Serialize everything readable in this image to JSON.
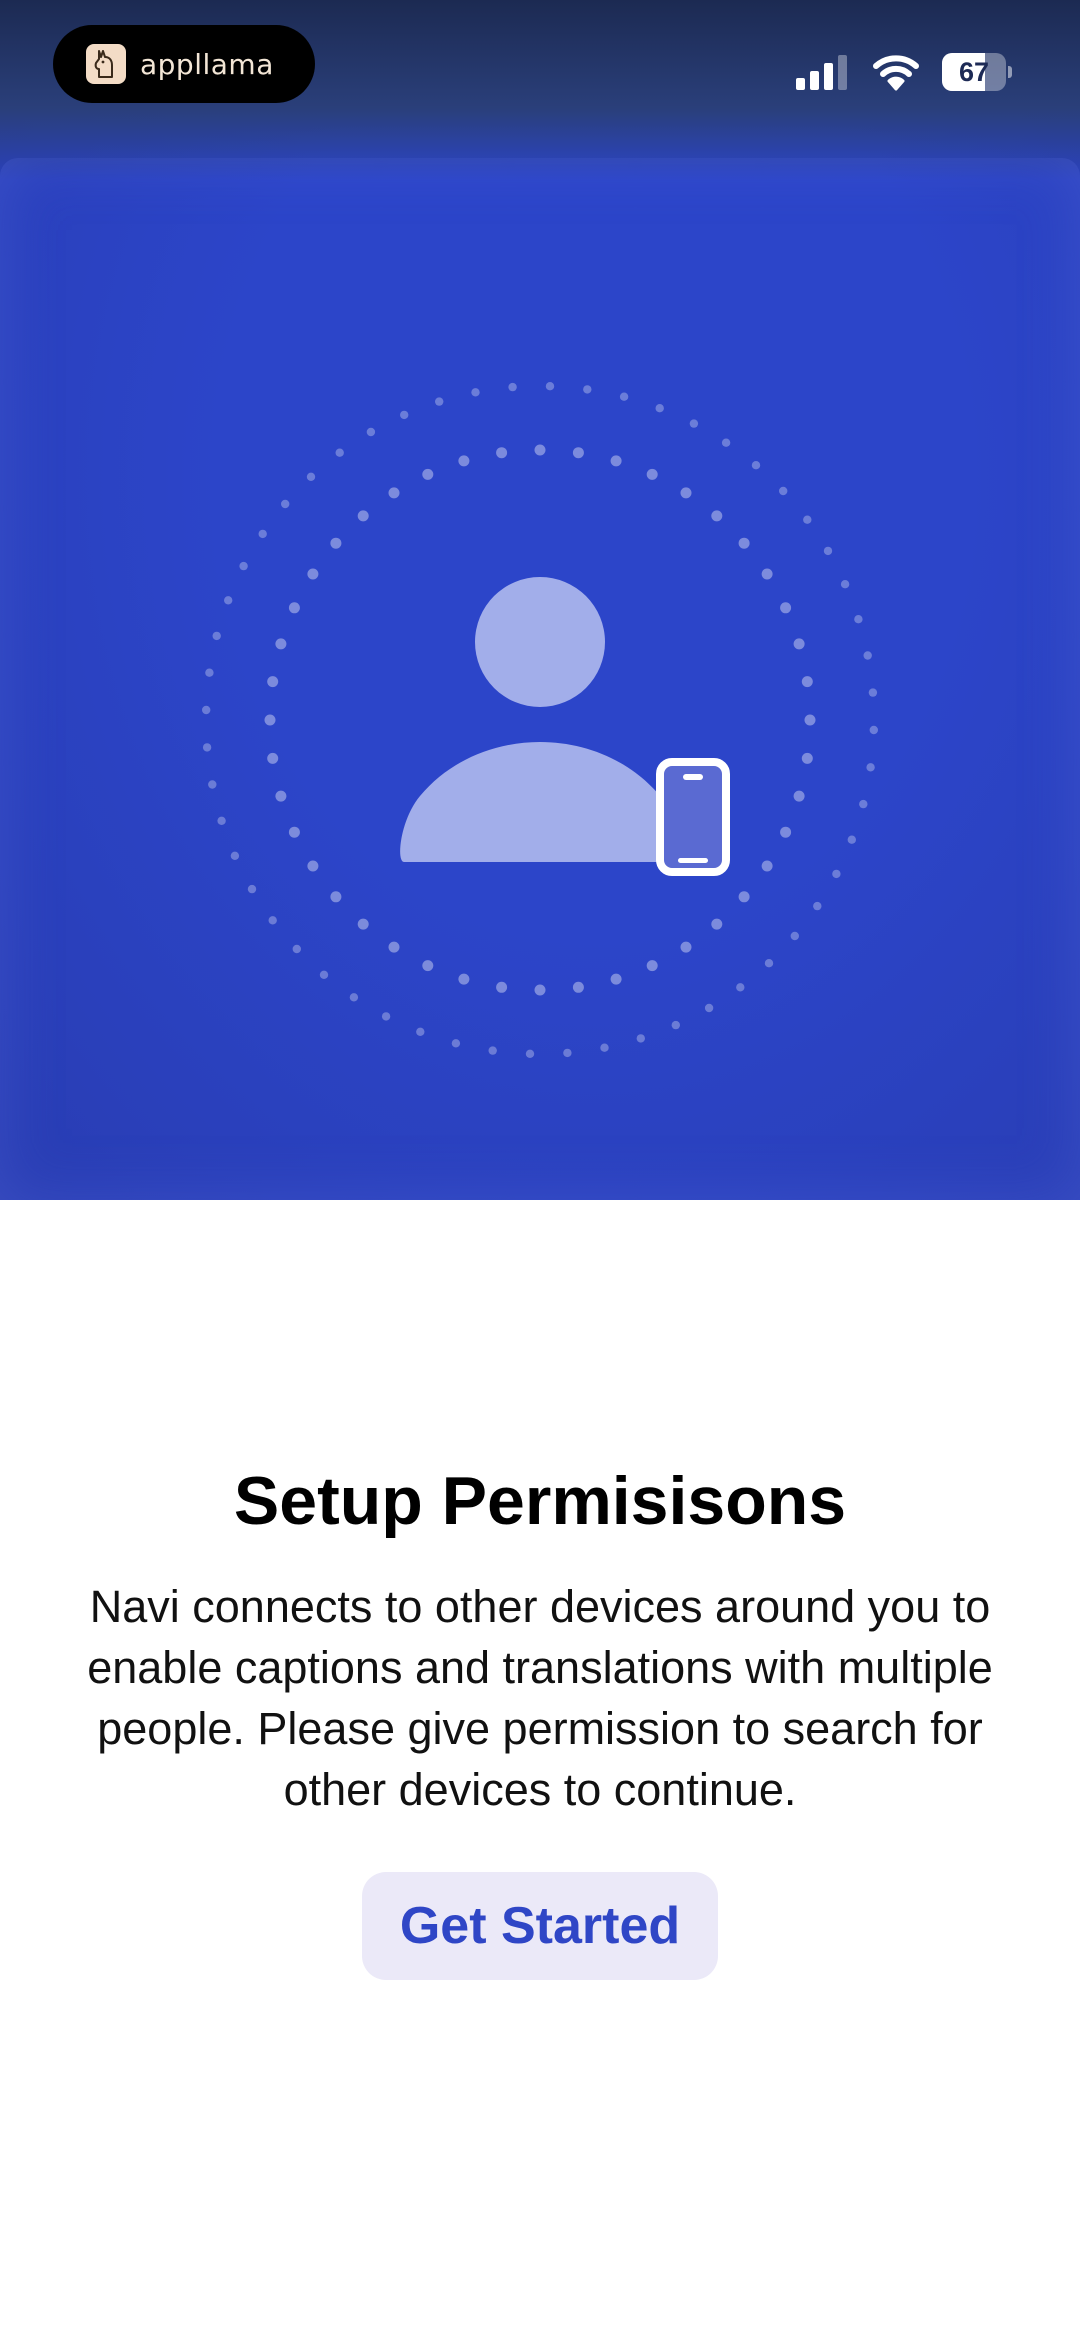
{
  "status_bar": {
    "brand_name": "appllama",
    "brand_icon": "llama-logo-icon",
    "signal_icon": "cellular-signal-icon",
    "wifi_icon": "wifi-icon",
    "battery_level": "67",
    "battery_fraction": 0.67
  },
  "hero": {
    "illustration_icons": [
      "dotted-ring-icon",
      "person-icon",
      "phone-icon"
    ],
    "background_color": "#2c45c9",
    "figure_color": "#a2aeea"
  },
  "content": {
    "title": "Setup Permisisons",
    "description": "Navi connects to other devices around you to enable captions and translations with multiple people. Please give permission to search for other devices to continue.",
    "button_label": "Get Started",
    "button_text_color": "#2f46c6",
    "button_bg_color": "#ebe9f8"
  }
}
